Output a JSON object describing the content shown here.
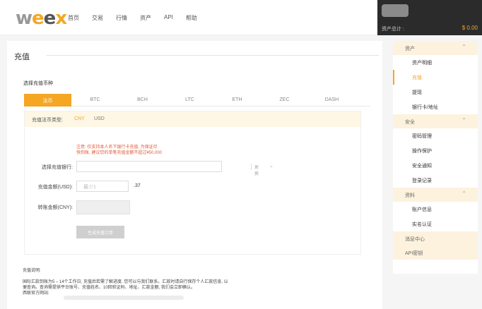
{
  "logo": {
    "w": "w",
    "e1": "e",
    "e2": "e",
    "x": "x"
  },
  "nav": [
    "首页",
    "交易",
    "行情",
    "资产",
    "API",
    "帮助"
  ],
  "account": {
    "total_label": "资产总计 :",
    "total_value": "$ 0.00"
  },
  "sidebar": {
    "assets": {
      "label": "资产",
      "items": [
        "资产明细",
        "充值",
        "提现",
        "银行卡/地址"
      ],
      "active": "充值"
    },
    "security": {
      "label": "安全",
      "items": [
        "密码管理",
        "操作保护",
        "安全通知",
        "登录记录"
      ]
    },
    "profile": {
      "label": "资料",
      "items": [
        "账户信息",
        "实名认证"
      ]
    },
    "messages": "消息中心",
    "api_key": "API密钥"
  },
  "page": {
    "title": "充值",
    "select_coin_label": "选择充值币种",
    "tabs": [
      "法币",
      "BTC",
      "BCH",
      "LTC",
      "ETH",
      "ZEC",
      "DASH"
    ],
    "active_tab": "法币",
    "fiat_type_label": "充值法币类型:",
    "fiat_options": [
      "CNY",
      "USD"
    ],
    "notice_line1": "注意: 仅支持本人名下银行卡充值, 为保证尽",
    "notice_line2": "快到账, 建议您的单笔充值金额不超过¥50,000",
    "bank_label": "选择充值银行:",
    "bank_change": "更换",
    "usd_label": "充值金额(USD):",
    "usd_placeholder": "最少1",
    "rate": ".37",
    "cny_label": "转账金额(CNY):",
    "generate_button": "生成充值订单",
    "desc_title": "充值说明:",
    "desc_line1": "国际汇款到账为5 – 14个工作日, 充值后若需了解进度, 您可以与我们联系。汇款时请自行保存个人汇款信息, 以",
    "desc_line2": "便查询。查询需提供平台账号、充值姓名、10回验证码、地址、汇款金额, 我们会立即确认。",
    "desc_line3": "西联官方网站:"
  },
  "colors": {
    "accent": "#f5a623",
    "dark_panel": "#2b2b2b",
    "notice": "#e05a3a"
  }
}
